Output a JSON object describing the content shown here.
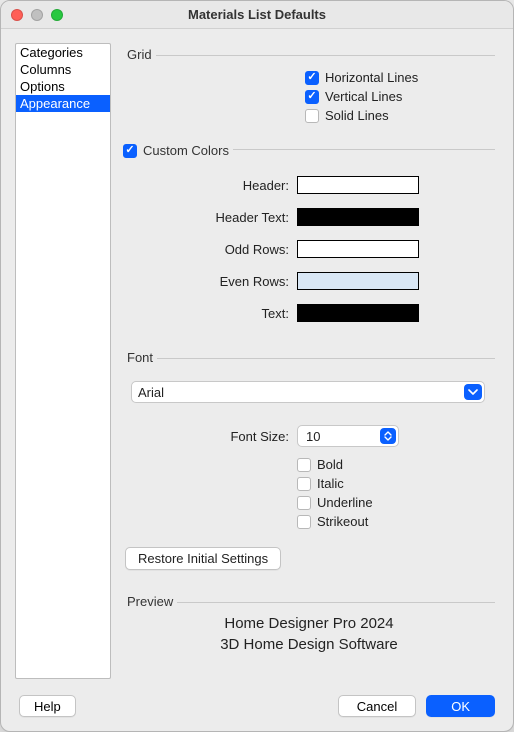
{
  "window": {
    "title": "Materials List Defaults"
  },
  "sidebar": {
    "items": [
      {
        "label": "Categories",
        "selected": false
      },
      {
        "label": "Columns",
        "selected": false
      },
      {
        "label": "Options",
        "selected": false
      },
      {
        "label": "Appearance",
        "selected": true
      }
    ]
  },
  "grid": {
    "title": "Grid",
    "horizontal": {
      "label": "Horizontal Lines",
      "checked": true
    },
    "vertical": {
      "label": "Vertical Lines",
      "checked": true
    },
    "solid": {
      "label": "Solid Lines",
      "checked": false
    }
  },
  "customColors": {
    "title": "Custom Colors",
    "checked": true,
    "rows": [
      {
        "label": "Header:",
        "color": "#ffffff"
      },
      {
        "label": "Header Text:",
        "color": "#000000"
      },
      {
        "label": "Odd Rows:",
        "color": "#ffffff"
      },
      {
        "label": "Even Rows:",
        "color": "#d9e7f5"
      },
      {
        "label": "Text:",
        "color": "#000000"
      }
    ]
  },
  "font": {
    "title": "Font",
    "family": "Arial",
    "sizeLabel": "Font Size:",
    "size": "10",
    "styles": {
      "bold": {
        "label": "Bold",
        "checked": false
      },
      "italic": {
        "label": "Italic",
        "checked": false
      },
      "underline": {
        "label": "Underline",
        "checked": false
      },
      "strikeout": {
        "label": "Strikeout",
        "checked": false
      }
    }
  },
  "restore": {
    "label": "Restore Initial Settings"
  },
  "preview": {
    "title": "Preview",
    "line1": "Home Designer Pro 2024",
    "line2": "3D Home Design Software"
  },
  "footer": {
    "help": "Help",
    "cancel": "Cancel",
    "ok": "OK"
  }
}
